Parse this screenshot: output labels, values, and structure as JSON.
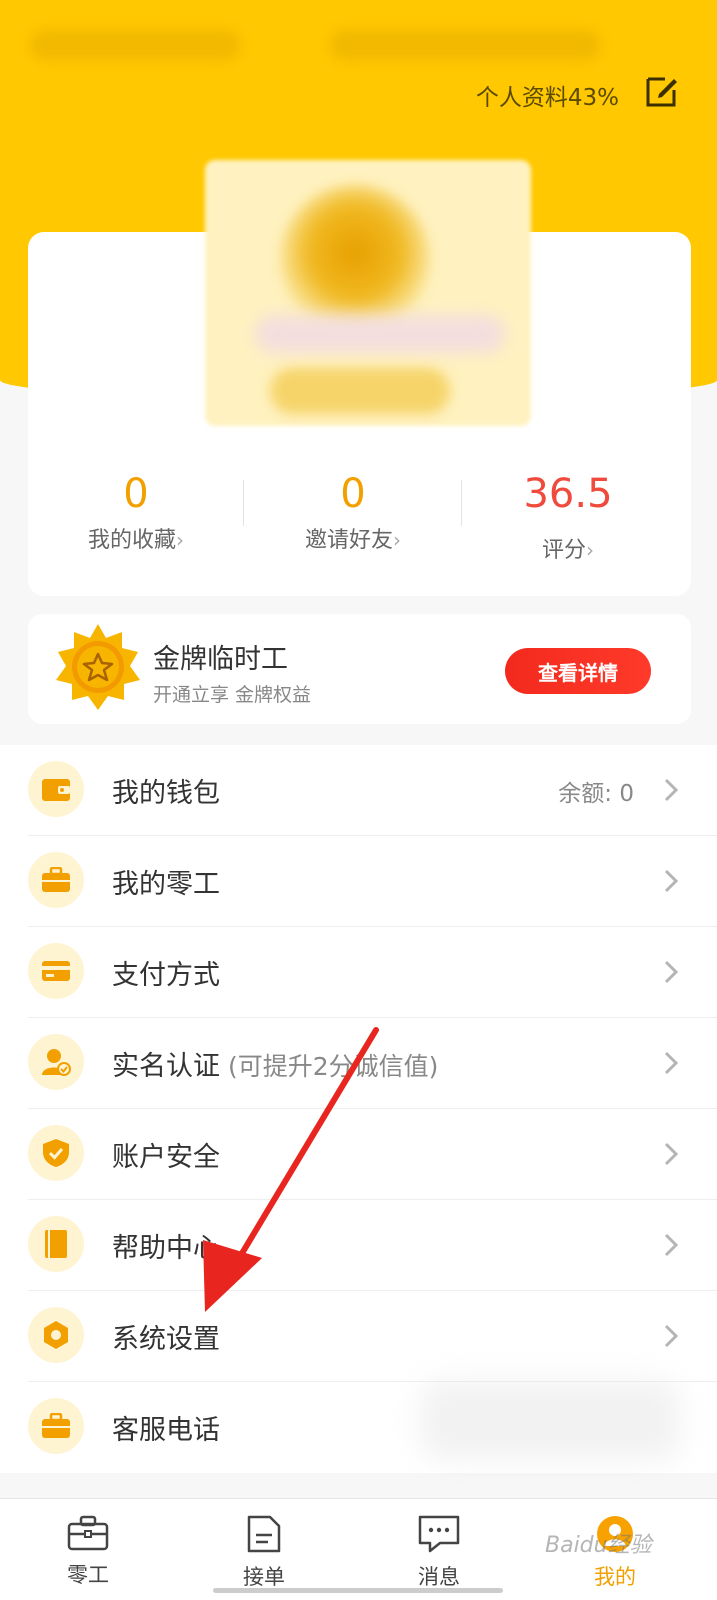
{
  "header": {
    "profile_completion": "个人资料43%",
    "edit_icon": "edit-icon"
  },
  "stats": [
    {
      "value": "0",
      "label": "我的收藏"
    },
    {
      "value": "0",
      "label": "邀请好友"
    },
    {
      "value": "36.5",
      "label": "评分"
    }
  ],
  "gold_member": {
    "title": "金牌临时工",
    "subtitle": "开通立享 金牌权益",
    "button": "查看详情"
  },
  "menu": [
    {
      "label": "我的钱包",
      "value": "余额: 0",
      "icon": "wallet-icon"
    },
    {
      "label": "我的零工",
      "icon": "briefcase-icon"
    },
    {
      "label": "支付方式",
      "icon": "card-icon"
    },
    {
      "label": "实名认证",
      "note": "(可提升2分诚信值)",
      "icon": "user-verify-icon"
    },
    {
      "label": "账户安全",
      "icon": "shield-icon"
    },
    {
      "label": "帮助中心",
      "icon": "book-icon"
    },
    {
      "label": "系统设置",
      "icon": "gear-icon"
    },
    {
      "label": "客服电话",
      "icon": "phone-briefcase-icon"
    }
  ],
  "tabs": [
    {
      "label": "零工",
      "icon": "briefcase-icon"
    },
    {
      "label": "接单",
      "icon": "document-icon"
    },
    {
      "label": "消息",
      "icon": "chat-icon"
    },
    {
      "label": "我的",
      "icon": "profile-icon",
      "active": true
    }
  ],
  "watermark": "Baidu经验",
  "colors": {
    "brand_yellow": "#ffc800",
    "accent_orange": "#f2a000",
    "score_red": "#f04a3c",
    "button_red": "#f22a1e",
    "annotation_arrow": "#e8251f"
  }
}
